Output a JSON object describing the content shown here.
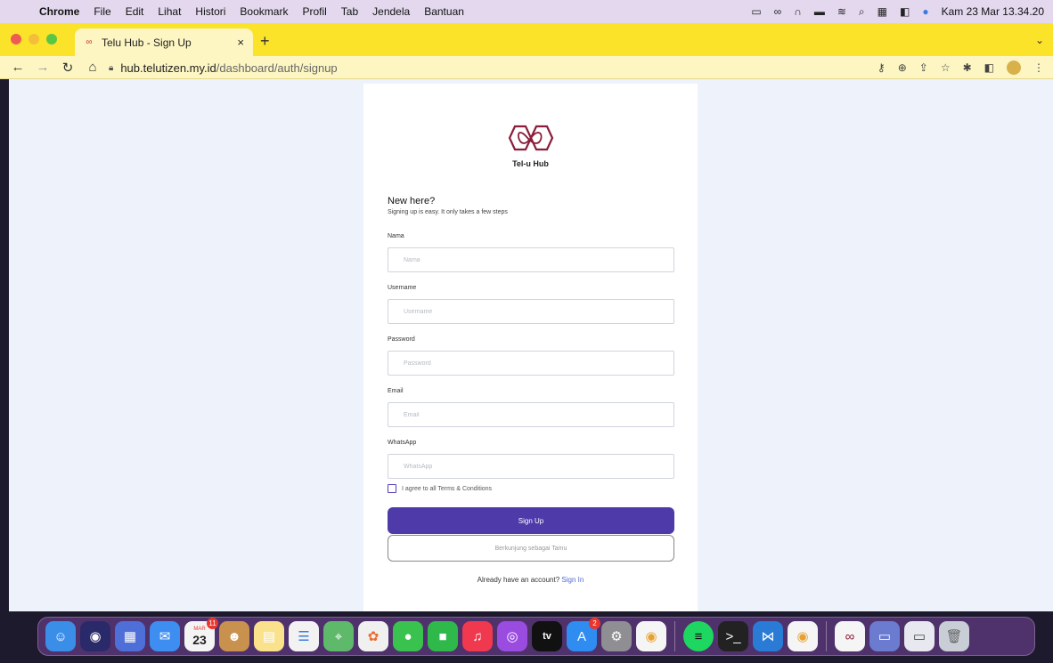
{
  "menubar": {
    "app_name": "Chrome",
    "items": [
      "File",
      "Edit",
      "Lihat",
      "Histori",
      "Bookmark",
      "Profil",
      "Tab",
      "Jendela",
      "Bantuan"
    ],
    "clock": "Kam 23 Mar  13.34.20"
  },
  "browser": {
    "tab_title": "Telu Hub - Sign Up",
    "tab_close": "×",
    "new_tab": "+",
    "tab_menu": "⌄",
    "url_domain": "hub.telutizen.my.id",
    "url_path": "/dashboard/auth/signup"
  },
  "page": {
    "logo_text": "Tel-u Hub",
    "heading": "New here?",
    "subheading": "Signing up is easy. It only takes a few steps",
    "fields": {
      "nama": {
        "label": "Nama",
        "placeholder": "Nama"
      },
      "username": {
        "label": "Username",
        "placeholder": "Username"
      },
      "password": {
        "label": "Password",
        "placeholder": "Password"
      },
      "email": {
        "label": "Email",
        "placeholder": "Email"
      },
      "whatsapp": {
        "label": "WhatsApp",
        "placeholder": "WhatsApp"
      }
    },
    "agree_text": "I agree to all Terms & Conditions",
    "signup_button": "Sign Up",
    "guest_button": "Berkunjung sebagai Tamu",
    "already_text": "Already have an account?",
    "signin_link": "Sign In"
  },
  "dock": {
    "calendar_month": "MAR",
    "calendar_day": "23",
    "calendar_badge": "11",
    "appstore_badge": "2",
    "appletv_label": "tv"
  },
  "colors": {
    "primary": "#4f3aaa",
    "tab_strip": "#fbe32a",
    "page_background": "#eef3fb",
    "link": "#4f6bd6"
  }
}
